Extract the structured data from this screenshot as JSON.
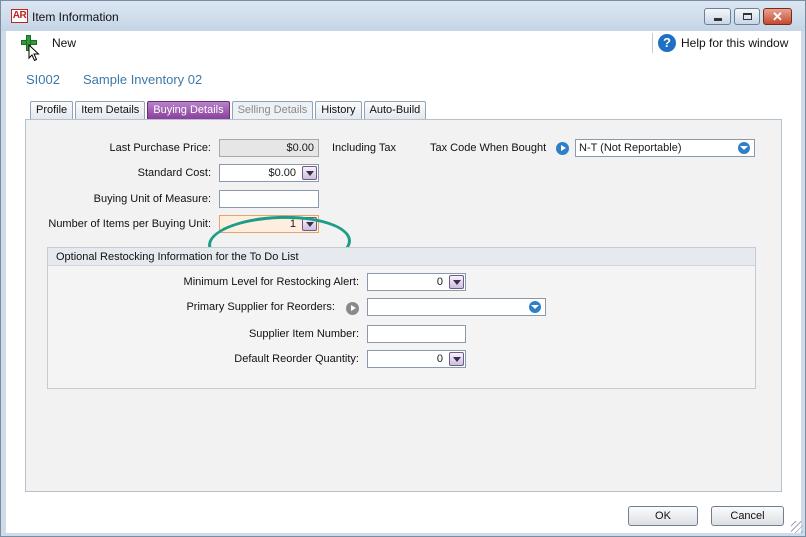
{
  "window": {
    "app_badge": "AR",
    "title": "Item Information"
  },
  "toolbar": {
    "new_label": "New",
    "help_label": "Help for this window"
  },
  "item": {
    "id": "SI002",
    "name": "Sample Inventory 02"
  },
  "tabs": [
    {
      "label": "Profile",
      "state": "normal"
    },
    {
      "label": "Item Details",
      "state": "normal"
    },
    {
      "label": "Buying Details",
      "state": "active"
    },
    {
      "label": "Selling Details",
      "state": "disabled"
    },
    {
      "label": "History",
      "state": "normal"
    },
    {
      "label": "Auto-Build",
      "state": "normal"
    }
  ],
  "buying": {
    "last_purchase_price_label": "Last Purchase Price:",
    "last_purchase_price": "$0.00",
    "including_tax_label": "Including Tax",
    "tax_code_label": "Tax Code When Bought",
    "tax_code_value": "N-T (Not Reportable)",
    "standard_cost_label": "Standard Cost:",
    "standard_cost": "$0.00",
    "buying_unit_label": "Buying Unit of Measure:",
    "buying_unit_value": "",
    "items_per_unit_label": "Number of Items per Buying Unit:",
    "items_per_unit_value": "1"
  },
  "restocking": {
    "title": "Optional Restocking Information for the To Do List",
    "min_level_label": "Minimum Level for Restocking Alert:",
    "min_level_value": "0",
    "primary_supplier_label": "Primary Supplier for Reorders:",
    "primary_supplier_value": "",
    "supplier_item_label": "Supplier Item Number:",
    "supplier_item_value": "",
    "reorder_qty_label": "Default Reorder Quantity:",
    "reorder_qty_value": "0"
  },
  "footer": {
    "ok_label": "OK",
    "cancel_label": "Cancel"
  },
  "colors": {
    "accent_purple": "#8a3f9c",
    "callout_teal": "#1d9c86",
    "link_blue": "#3d78a8"
  }
}
